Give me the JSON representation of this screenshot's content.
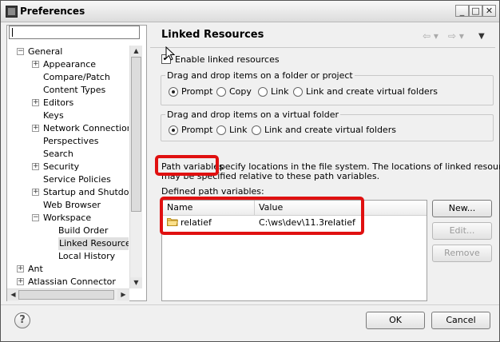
{
  "window": {
    "title": "Preferences"
  },
  "filter": {
    "value": ""
  },
  "tree": [
    {
      "label": "General",
      "expander": "−",
      "level": 0
    },
    {
      "label": "Appearance",
      "expander": "+",
      "level": 1
    },
    {
      "label": "Compare/Patch",
      "expander": "",
      "level": 1
    },
    {
      "label": "Content Types",
      "expander": "",
      "level": 1
    },
    {
      "label": "Editors",
      "expander": "+",
      "level": 1
    },
    {
      "label": "Keys",
      "expander": "",
      "level": 1
    },
    {
      "label": "Network Connections",
      "expander": "+",
      "level": 1
    },
    {
      "label": "Perspectives",
      "expander": "",
      "level": 1
    },
    {
      "label": "Search",
      "expander": "",
      "level": 1
    },
    {
      "label": "Security",
      "expander": "+",
      "level": 1
    },
    {
      "label": "Service Policies",
      "expander": "",
      "level": 1
    },
    {
      "label": "Startup and Shutdown",
      "expander": "+",
      "level": 1
    },
    {
      "label": "Web Browser",
      "expander": "",
      "level": 1
    },
    {
      "label": "Workspace",
      "expander": "−",
      "level": 1
    },
    {
      "label": "Build Order",
      "expander": "",
      "level": 2
    },
    {
      "label": "Linked Resources",
      "expander": "",
      "level": 2,
      "selected": true
    },
    {
      "label": "Local History",
      "expander": "",
      "level": 2
    },
    {
      "label": "Ant",
      "expander": "+",
      "level": 0
    },
    {
      "label": "Atlassian Connector",
      "expander": "+",
      "level": 0
    }
  ],
  "content": {
    "title": "Linked Resources",
    "enable_label": "Enable linked resources",
    "group1": {
      "title": "Drag and drop items on a folder or project",
      "options": [
        "Prompt",
        "Copy",
        "Link",
        "Link and create virtual folders"
      ],
      "selected": 0
    },
    "group2": {
      "title": "Drag and drop items on a virtual folder",
      "options": [
        "Prompt",
        "Link",
        "Link and create virtual folders"
      ],
      "selected": 0
    },
    "path_desc_prefix": "Path variables",
    "path_desc_rest": " specify locations in the file system. The locations of linked resources",
    "path_desc_line2": "may be specified relative to these path variables.",
    "defined_label": "Defined path variables:",
    "table": {
      "headers": [
        "Name",
        "Value"
      ],
      "rows": [
        {
          "name": "relatief",
          "value": "C:\\ws\\dev\\11.3relatief"
        }
      ]
    },
    "buttons": {
      "new": "New...",
      "edit": "Edit...",
      "remove": "Remove"
    }
  },
  "footer": {
    "help": "?",
    "ok": "OK",
    "cancel": "Cancel"
  },
  "icons": [
    "app-icon",
    "minimize-icon",
    "maximize-icon",
    "close-icon",
    "back-arrow-icon",
    "forward-arrow-icon",
    "menu-dropdown-icon",
    "folder-icon",
    "help-icon"
  ]
}
